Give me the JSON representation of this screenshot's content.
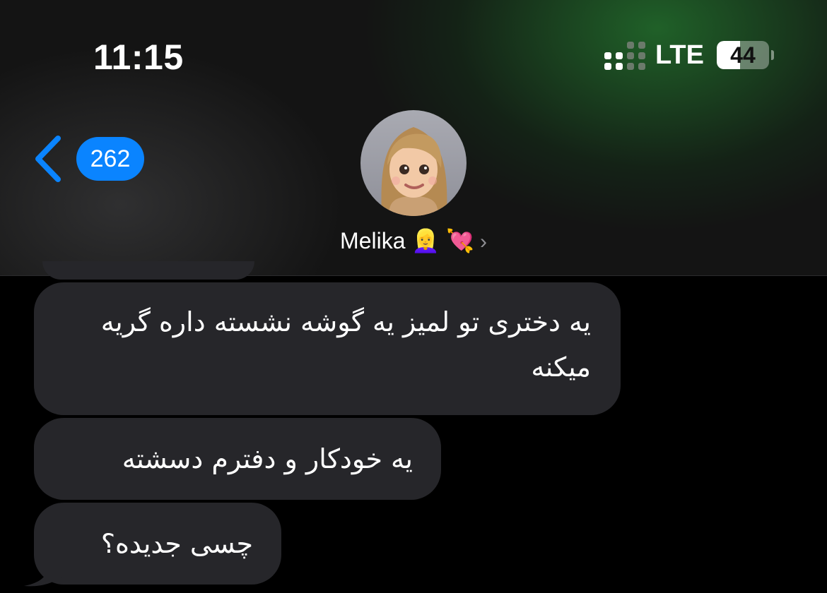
{
  "status_bar": {
    "time": "11:15",
    "network": "LTE",
    "battery_level": "44",
    "battery_fraction": 0.44,
    "signal_bars_active": 2,
    "signal_bars_total": 4
  },
  "nav": {
    "back_icon": "chevron-left-icon",
    "unread_count": "262"
  },
  "contact": {
    "name": "Melika 👱‍♀️ 💘",
    "disclosure_icon": "chevron-right-icon"
  },
  "messages": [
    {
      "sender": "incoming",
      "text": "یه دختری تو لمیز یه گوشه نشسته داره گریه میکنه"
    },
    {
      "sender": "incoming",
      "text": "یه خودکار و دفترم دسشته"
    },
    {
      "sender": "incoming",
      "text": "چسی جدیده؟"
    }
  ],
  "colors": {
    "accent": "#0a84ff",
    "bubble_incoming": "#26262a",
    "background": "#000000"
  }
}
